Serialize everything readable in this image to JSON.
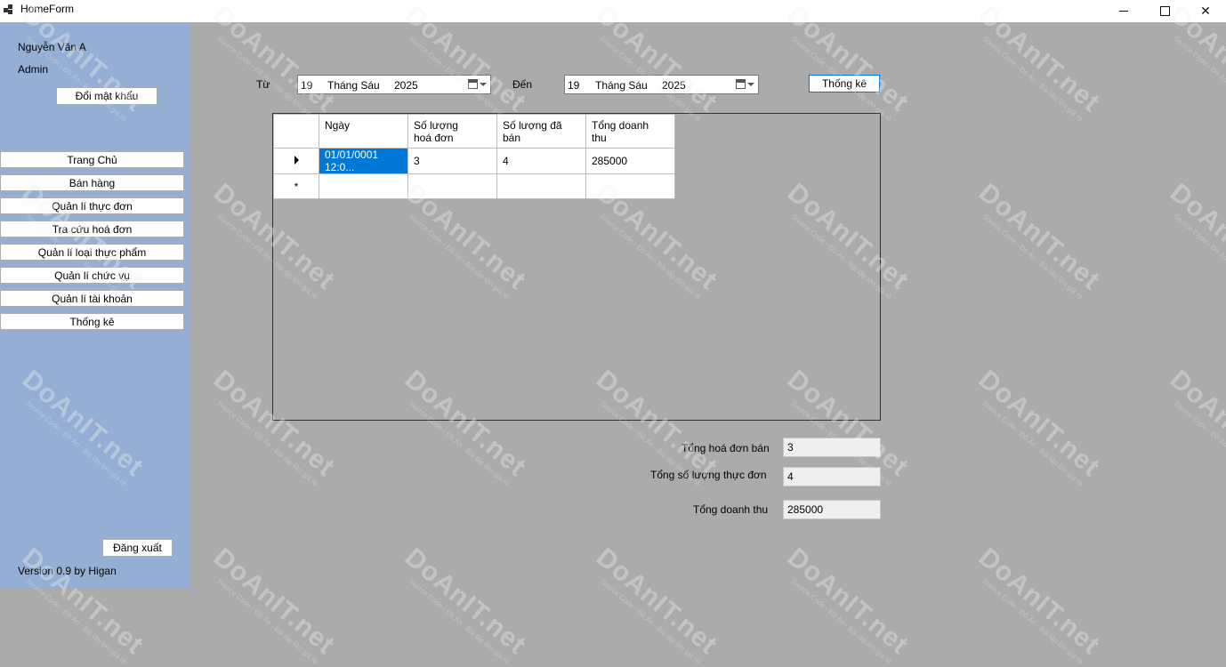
{
  "window": {
    "title": "HomeForm"
  },
  "sidebar": {
    "user_name": "Nguyễn Văn A",
    "role": "Admin",
    "change_password": "Đổi mật khẩu",
    "nav": [
      "Trang Chủ",
      "Bán hàng",
      "Quản lí thực đơn",
      "Tra cứu hoá đơn",
      "Quản lí loại thực phẩm",
      "Quản lí chức vụ",
      "Quản lí tài khoản",
      "Thống kê"
    ],
    "logout": "Đăng xuất",
    "version": "Version 0.9 by Higan"
  },
  "filter": {
    "from_label": "Từ",
    "from_day": "19",
    "from_month": "Tháng Sáu",
    "from_year": "2025",
    "to_label": "Đến",
    "to_day": "19",
    "to_month": "Tháng Sáu",
    "to_year": "2025",
    "stat_button": "Thống kê"
  },
  "grid": {
    "headers": [
      "Ngày",
      "Số lượng hoá đơn",
      "Số lượng đã bán",
      "Tổng doanh thu"
    ],
    "rows": [
      [
        "01/01/0001 12:0...",
        "3",
        "4",
        "285000"
      ]
    ],
    "new_row_marker": "*"
  },
  "summary": {
    "total_invoices_label": "Tổng hoá đơn bán",
    "total_invoices_value": "3",
    "total_items_label": "Tổng số lượng thực đơn",
    "total_items_value": "4",
    "total_revenue_label": "Tổng doanh thu",
    "total_revenue_value": "285000"
  },
  "watermark": {
    "logo": "DoAnIT.net",
    "tagline": "Source Code - Đồ Án - Bài tập lớn giá rẻ"
  },
  "icons": {
    "calendar": "calendar-icon",
    "dropdown": "chevron-down-icon",
    "row_pointer": "row-pointer-icon"
  },
  "colors": {
    "sidebar": "#94afd3",
    "main": "#ababab",
    "selection": "#0078d7"
  }
}
